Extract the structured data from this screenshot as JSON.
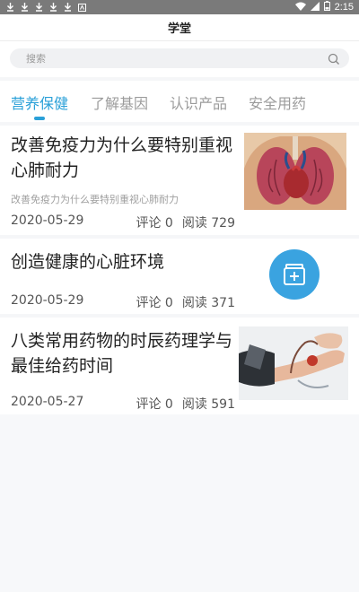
{
  "status_bar": {
    "notification_icons": [
      "download-icon",
      "download-icon",
      "download-icon",
      "download-icon",
      "download-icon",
      "app-icon"
    ],
    "battery_level": "2",
    "time": "2:15"
  },
  "header": {
    "title": "学堂"
  },
  "search": {
    "placeholder": "搜索"
  },
  "tabs": [
    {
      "label": "营养保健",
      "active": true
    },
    {
      "label": "了解基因",
      "active": false
    },
    {
      "label": "认识产品",
      "active": false
    },
    {
      "label": "安全用药",
      "active": false
    }
  ],
  "articles": [
    {
      "title": "改善免疫力为什么要特别重视心肺耐力",
      "subtitle": "改善免疫力为什么要特别重视心肺耐力",
      "date": "2020-05-29",
      "comments": "评论 0",
      "reads": "阅读 729",
      "thumbnail": "lungs-heart-illustration"
    },
    {
      "title": "创造健康的心脏环境",
      "subtitle": "",
      "date": "2020-05-29",
      "comments": "评论 0",
      "reads": "阅读 371",
      "thumbnail": "medicine-box-icon"
    },
    {
      "title": "八类常用药物的时辰药理学与最佳给药时间",
      "subtitle": "",
      "date": "2020-05-27",
      "comments": "评论 0",
      "reads": "阅读 591",
      "thumbnail": "blood-pressure-photo"
    }
  ],
  "colors": {
    "accent": "#2aa0d8",
    "status_bar": "#7a7a7a",
    "background": "#f5f6f8"
  }
}
